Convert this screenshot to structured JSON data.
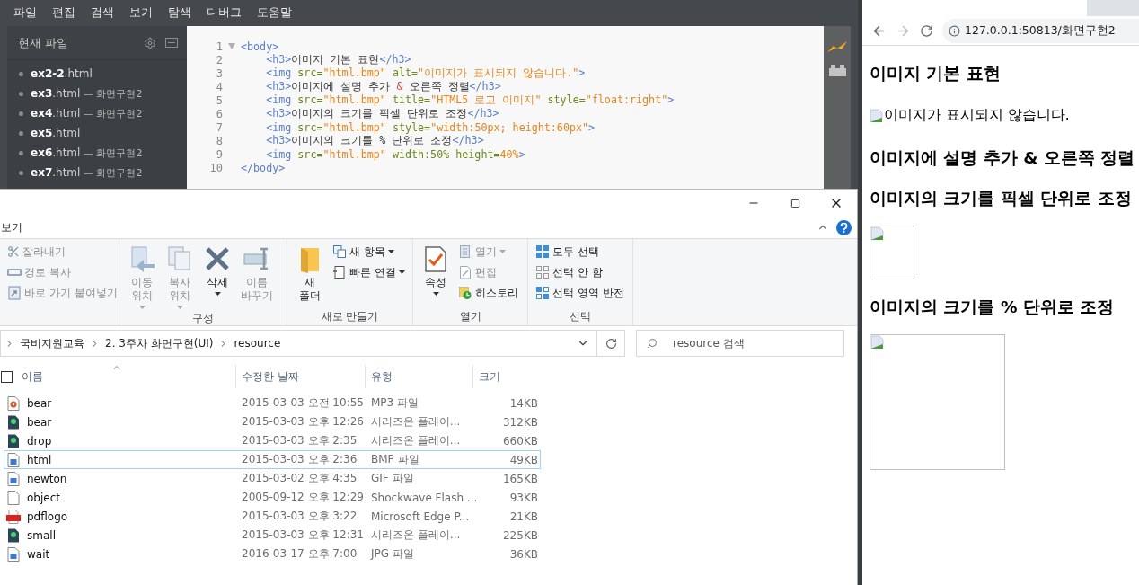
{
  "editor": {
    "menu": [
      "파일",
      "편집",
      "검색",
      "보기",
      "탐색",
      "디버그",
      "도움말"
    ],
    "sidebar": {
      "title": "현재 파일",
      "files": [
        {
          "name": "ex2-2",
          "ext": ".html"
        },
        {
          "name": "ex3",
          "ext": ".html",
          "folder": "— 화면구현2"
        },
        {
          "name": "ex4",
          "ext": ".html",
          "folder": "— 화면구현2"
        },
        {
          "name": "ex5",
          "ext": ".html"
        },
        {
          "name": "ex6",
          "ext": ".html",
          "folder": "— 화면구현2"
        },
        {
          "name": "ex7",
          "ext": ".html",
          "folder": "— 화면구현2"
        }
      ]
    },
    "lines": [
      {
        "number": "1",
        "foldable": true,
        "tokens": [
          {
            "kind": "tag",
            "text": "<body>"
          }
        ]
      },
      {
        "number": "2",
        "foldable": false,
        "tokens": [
          {
            "kind": "tag",
            "text": "    <h3>"
          },
          {
            "kind": "text",
            "text": "이미지 기본 표현"
          },
          {
            "kind": "tag",
            "text": "</h3>"
          }
        ]
      },
      {
        "number": "3",
        "foldable": false,
        "tokens": [
          {
            "kind": "tag",
            "text": "    <img"
          },
          {
            "kind": "attr",
            "text": " src="
          },
          {
            "kind": "str",
            "text": "\"html.bmp\""
          },
          {
            "kind": "attr",
            "text": " alt="
          },
          {
            "kind": "str",
            "text": "\"이미지가 표시되지 않습니다.\""
          },
          {
            "kind": "tag",
            "text": ">"
          }
        ]
      },
      {
        "number": "4",
        "foldable": false,
        "tokens": [
          {
            "kind": "tag",
            "text": "    <h3>"
          },
          {
            "kind": "text",
            "text": "이미지에 설명 추가 "
          },
          {
            "kind": "ent",
            "text": "&"
          },
          {
            "kind": "text",
            "text": " 오른쪽 정렬"
          },
          {
            "kind": "tag",
            "text": "</h3>"
          }
        ]
      },
      {
        "number": "5",
        "foldable": false,
        "tokens": [
          {
            "kind": "tag",
            "text": "    <img"
          },
          {
            "kind": "attr",
            "text": " src="
          },
          {
            "kind": "str",
            "text": "\"html.bmp\""
          },
          {
            "kind": "attr",
            "text": " title="
          },
          {
            "kind": "str",
            "text": "\"HTML5 로고 이미지\""
          },
          {
            "kind": "attr",
            "text": " style="
          },
          {
            "kind": "str",
            "text": "\"float:right\""
          },
          {
            "kind": "tag",
            "text": ">"
          }
        ]
      },
      {
        "number": "6",
        "foldable": false,
        "tokens": [
          {
            "kind": "tag",
            "text": "    <h3>"
          },
          {
            "kind": "text",
            "text": "이미지의 크기를 픽셀 단위로 조정"
          },
          {
            "kind": "tag",
            "text": "</h3>"
          }
        ]
      },
      {
        "number": "7",
        "foldable": false,
        "tokens": [
          {
            "kind": "tag",
            "text": "    <img"
          },
          {
            "kind": "attr",
            "text": " src="
          },
          {
            "kind": "str",
            "text": "\"html.bmp\""
          },
          {
            "kind": "attr",
            "text": " style="
          },
          {
            "kind": "str",
            "text": "\"width:50px; height:60px\""
          },
          {
            "kind": "tag",
            "text": ">"
          }
        ]
      },
      {
        "number": "8",
        "foldable": false,
        "tokens": [
          {
            "kind": "tag",
            "text": "    <h3>"
          },
          {
            "kind": "text",
            "text": "이미지의 크기를 % 단위로 조정"
          },
          {
            "kind": "tag",
            "text": "</h3>"
          }
        ]
      },
      {
        "number": "9",
        "foldable": false,
        "tokens": [
          {
            "kind": "tag",
            "text": "    <img"
          },
          {
            "kind": "attr",
            "text": " src="
          },
          {
            "kind": "str",
            "text": "\"html.bmp\""
          },
          {
            "kind": "attr",
            "text": " width:50% height="
          },
          {
            "kind": "str",
            "text": "40%"
          },
          {
            "kind": "tag",
            "text": ">"
          }
        ]
      },
      {
        "number": "10",
        "foldable": false,
        "tokens": [
          {
            "kind": "tag",
            "text": "</body>"
          }
        ]
      }
    ]
  },
  "explorer": {
    "ribbon_tab": "보기",
    "groups": [
      {
        "items": [
          {
            "label": "잘라내기",
            "kind": "small",
            "disabled": true,
            "dropdown": false
          },
          {
            "label": "경로 복사",
            "kind": "small",
            "disabled": true,
            "dropdown": false
          },
          {
            "label": "바로 가기 붙여넣기",
            "kind": "small",
            "disabled": true,
            "dropdown": false
          }
        ]
      },
      {
        "label": "구성",
        "items": [
          {
            "label": "이동\n위치",
            "kind": "large",
            "disabled": true,
            "dropdown": true
          },
          {
            "label": "복사\n위치",
            "kind": "large",
            "disabled": true,
            "dropdown": true
          },
          {
            "label": "삭제",
            "kind": "large",
            "disabled": false,
            "dropdown": true
          },
          {
            "label": "이름\n바꾸기",
            "kind": "large",
            "disabled": true,
            "dropdown": false
          }
        ]
      },
      {
        "label": "새로 만들기",
        "items": [
          {
            "label": "새\n폴더",
            "kind": "large",
            "disabled": false,
            "dropdown": false
          },
          {
            "label": "새 항목",
            "kind": "small",
            "disabled": false,
            "dropdown": true
          },
          {
            "label": "빠른 연결",
            "kind": "small",
            "disabled": false,
            "dropdown": true
          }
        ]
      },
      {
        "label": "열기",
        "items": [
          {
            "label": "속성",
            "kind": "large",
            "disabled": false,
            "dropdown": true
          },
          {
            "label": "열기",
            "kind": "small",
            "disabled": true,
            "dropdown": true
          },
          {
            "label": "편집",
            "kind": "small",
            "disabled": true,
            "dropdown": false
          },
          {
            "label": "히스토리",
            "kind": "small",
            "disabled": false,
            "dropdown": false
          }
        ]
      },
      {
        "label": "선택",
        "items": [
          {
            "label": "모두 선택",
            "kind": "small",
            "disabled": false,
            "dropdown": false
          },
          {
            "label": "선택 안 함",
            "kind": "small",
            "disabled": false,
            "dropdown": false
          },
          {
            "label": "선택 영역 반전",
            "kind": "small",
            "disabled": false,
            "dropdown": false
          }
        ]
      }
    ],
    "path": [
      "국비지원교육",
      "2. 3주차 화면구현(UI)",
      "resource"
    ],
    "search": {
      "placeholder": "resource 검색"
    },
    "select_all": {
      "checked": false
    },
    "columns": [
      "이름",
      "수정한 날짜",
      "유형",
      "크기"
    ],
    "files": [
      {
        "kind": "audio",
        "name": "bear",
        "date": "2015-03-03 오전 10:55",
        "type": "MP3 파일",
        "size": "14KB",
        "selected": false
      },
      {
        "kind": "video",
        "name": "bear",
        "date": "2015-03-03 오후 12:26",
        "type": "시리즈온 플레이...",
        "size": "312KB",
        "selected": false
      },
      {
        "kind": "video",
        "name": "drop",
        "date": "2015-03-03 오후 2:35",
        "type": "시리즈온 플레이...",
        "size": "660KB",
        "selected": false
      },
      {
        "kind": "image",
        "name": "html",
        "date": "2015-03-03 오후 2:36",
        "type": "BMP 파일",
        "size": "49KB",
        "selected": true
      },
      {
        "kind": "image",
        "name": "newton",
        "date": "2015-03-02 오후 4:35",
        "type": "GIF 파일",
        "size": "165KB",
        "selected": false
      },
      {
        "kind": "blank",
        "name": "object",
        "date": "2005-09-12 오후 12:29",
        "type": "Shockwave Flash ...",
        "size": "93KB",
        "selected": false
      },
      {
        "kind": "pdf",
        "name": "pdflogo",
        "date": "2015-03-03 오후 3:22",
        "type": "Microsoft Edge P...",
        "size": "21KB",
        "selected": false
      },
      {
        "kind": "video",
        "name": "small",
        "date": "2015-03-03 오후 12:31",
        "type": "시리즈온 플레이...",
        "size": "225KB",
        "selected": false
      },
      {
        "kind": "image",
        "name": "wait",
        "date": "2016-03-17 오후 7:00",
        "type": "JPG 파일",
        "size": "36KB",
        "selected": false
      }
    ]
  },
  "browser": {
    "address": "127.0.0.1:50813/화면구현2",
    "blocks": [
      {
        "kind": "heading",
        "text": "이미지 기본 표현"
      },
      {
        "kind": "alt",
        "text": "이미지가 표시되지 않습니다."
      },
      {
        "kind": "heading",
        "text": "이미지에 설명 추가 & 오른쪽 정렬"
      },
      {
        "kind": "heading",
        "text": "이미지의 크기를 픽셀 단위로 조정"
      },
      {
        "kind": "thumb"
      },
      {
        "kind": "heading",
        "text": "이미지의 크기를 % 단위로 조정"
      },
      {
        "kind": "image"
      }
    ]
  }
}
